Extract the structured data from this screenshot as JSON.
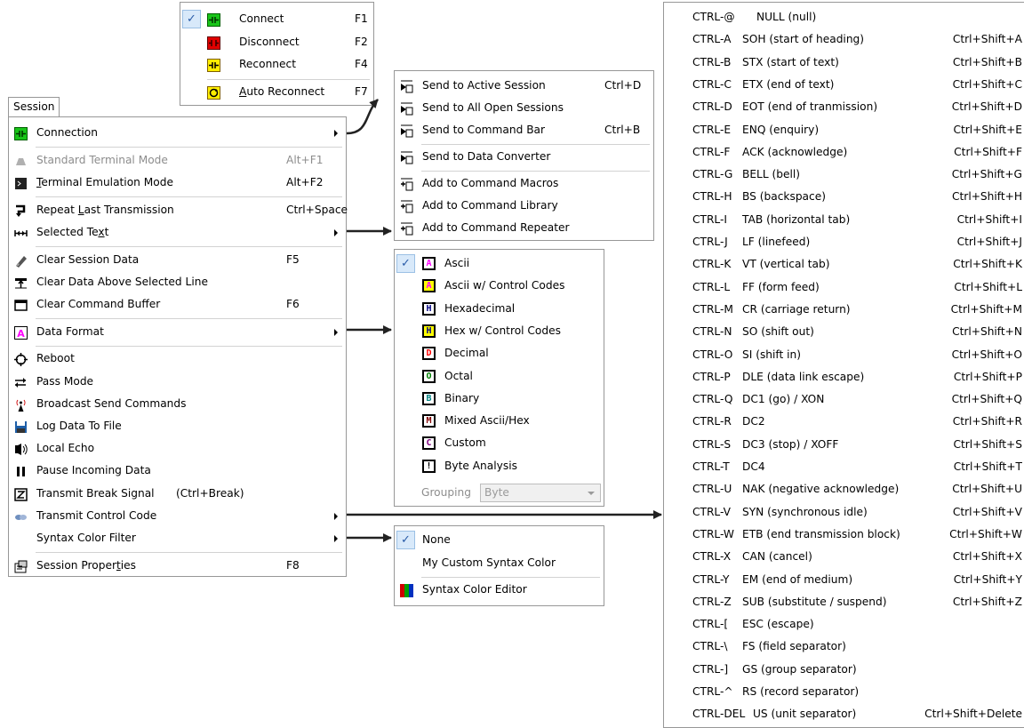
{
  "session_tab": "Session",
  "session_menu": [
    {
      "label": "Connection",
      "icon": "connect-icon",
      "submenu": true
    },
    {
      "sep": true
    },
    {
      "label": "Standard Terminal Mode",
      "icon": "terminal-mode-icon",
      "shortcut": "Alt+F1",
      "disabled": true
    },
    {
      "label": "Terminal Emulation Mode",
      "icon": "terminal-emulation-icon",
      "shortcut": "Alt+F2",
      "ul": "T"
    },
    {
      "sep": true
    },
    {
      "label": "Repeat Last Transmission",
      "icon": "repeat-icon",
      "shortcut": "Ctrl+Space",
      "ul": "L"
    },
    {
      "label": "Selected Text",
      "icon": "selected-text-icon",
      "submenu": true,
      "ul": "x"
    },
    {
      "sep": true
    },
    {
      "label": "Clear Session Data",
      "icon": "eraser-icon",
      "shortcut": "F5"
    },
    {
      "label": "Clear Data Above Selected Line",
      "icon": "clear-above-icon"
    },
    {
      "label": "Clear Command Buffer",
      "icon": "clear-buffer-icon",
      "shortcut": "F6"
    },
    {
      "sep": true
    },
    {
      "label": "Data Format",
      "icon": "data-format-icon",
      "submenu": true
    },
    {
      "sep": true
    },
    {
      "label": "Reboot",
      "icon": "reboot-icon"
    },
    {
      "label": "Pass Mode",
      "icon": "pass-mode-icon"
    },
    {
      "label": "Broadcast Send Commands",
      "icon": "broadcast-icon"
    },
    {
      "label": "Log Data To File",
      "icon": "save-icon"
    },
    {
      "label": "Local Echo",
      "icon": "echo-icon"
    },
    {
      "label": "Pause Incoming Data",
      "icon": "pause-icon"
    },
    {
      "label": "Transmit Break Signal",
      "icon": "break-icon",
      "shortcut_inline": "(Ctrl+Break)"
    },
    {
      "label": "Transmit Control Code",
      "icon": "control-code-icon",
      "submenu": true
    },
    {
      "label": "Syntax Color Filter",
      "icon": "",
      "submenu": true
    },
    {
      "sep": true
    },
    {
      "label": "Session Properties",
      "icon": "properties-icon",
      "shortcut": "F8",
      "ul": "t"
    }
  ],
  "connection_menu": [
    {
      "label": "Connect",
      "shortcut": "F1",
      "checked": true,
      "icon": "connect-icon"
    },
    {
      "label": "Disconnect",
      "shortcut": "F2",
      "icon": "disconnect-icon"
    },
    {
      "label": "Reconnect",
      "shortcut": "F4",
      "icon": "reconnect-icon"
    },
    {
      "sep": true
    },
    {
      "label": "Auto Reconnect",
      "shortcut": "F7",
      "icon": "auto-reconnect-icon",
      "ul": "A"
    }
  ],
  "selected_text_menu": [
    {
      "label": "Send to Active Session",
      "shortcut": "Ctrl+D",
      "icon": "send-active-icon"
    },
    {
      "label": "Send to All Open Sessions",
      "icon": "send-all-icon"
    },
    {
      "label": "Send to Command Bar",
      "shortcut": "Ctrl+B",
      "icon": "send-command-bar-icon"
    },
    {
      "sep": true
    },
    {
      "label": "Send to Data Converter",
      "icon": "send-converter-icon"
    },
    {
      "sep": true
    },
    {
      "label": "Add to Command Macros",
      "icon": "add-macros-icon"
    },
    {
      "label": "Add to Command Library",
      "icon": "add-library-icon"
    },
    {
      "label": "Add to Command Repeater",
      "icon": "add-repeater-icon"
    }
  ],
  "data_format_menu": [
    {
      "label": "Ascii",
      "letter": "A",
      "color": "#ff00ff",
      "bg": "#ffffff",
      "checked": true
    },
    {
      "label": "Ascii w/ Control Codes",
      "letter": "A",
      "color": "#ff00ff",
      "bg": "#ffff00"
    },
    {
      "label": "Hexadecimal",
      "letter": "H",
      "color": "#000080",
      "bg": "#ffffff"
    },
    {
      "label": "Hex w/ Control Codes",
      "letter": "H",
      "color": "#000080",
      "bg": "#ffff00"
    },
    {
      "label": "Decimal",
      "letter": "D",
      "color": "#ff0000",
      "bg": "#ffffff"
    },
    {
      "label": "Octal",
      "letter": "O",
      "color": "#008000",
      "bg": "#ffffff"
    },
    {
      "label": "Binary",
      "letter": "B",
      "color": "#008080",
      "bg": "#ffffff"
    },
    {
      "label": "Mixed Ascii/Hex",
      "letter": "M",
      "color": "#800000",
      "bg": "#ffffff"
    },
    {
      "label": "Custom",
      "letter": "C",
      "color": "#800080",
      "bg": "#ffffff"
    },
    {
      "label": "Byte Analysis",
      "letter": "!",
      "color": "#000000",
      "bg": "#ffffff"
    }
  ],
  "grouping": {
    "label": "Grouping",
    "value": "Byte"
  },
  "syntax_menu": [
    {
      "label": "None",
      "checked": true
    },
    {
      "label": "My Custom Syntax Color"
    },
    {
      "sep": true
    },
    {
      "label": "Syntax Color Editor",
      "icon": "color-editor-icon"
    }
  ],
  "control_codes": [
    {
      "code": "CTRL-@",
      "desc": "NULL (null)",
      "shortcut": ""
    },
    {
      "code": "CTRL-A",
      "desc": "SOH (start of heading)",
      "shortcut": "Ctrl+Shift+A"
    },
    {
      "code": "CTRL-B",
      "desc": "STX (start of text)",
      "shortcut": "Ctrl+Shift+B"
    },
    {
      "code": "CTRL-C",
      "desc": "ETX (end of text)",
      "shortcut": "Ctrl+Shift+C"
    },
    {
      "code": "CTRL-D",
      "desc": "EOT (end of tranmission)",
      "shortcut": "Ctrl+Shift+D"
    },
    {
      "code": "CTRL-E",
      "desc": "ENQ (enquiry)",
      "shortcut": "Ctrl+Shift+E"
    },
    {
      "code": "CTRL-F",
      "desc": "ACK (acknowledge)",
      "shortcut": "Ctrl+Shift+F"
    },
    {
      "code": "CTRL-G",
      "desc": "BELL (bell)",
      "shortcut": "Ctrl+Shift+G"
    },
    {
      "code": "CTRL-H",
      "desc": "BS (backspace)",
      "shortcut": "Ctrl+Shift+H"
    },
    {
      "code": "CTRL-I",
      "desc": "TAB (horizontal tab)",
      "shortcut": "Ctrl+Shift+I"
    },
    {
      "code": "CTRL-J",
      "desc": "LF (linefeed)",
      "shortcut": "Ctrl+Shift+J"
    },
    {
      "code": "CTRL-K",
      "desc": "VT (vertical tab)",
      "shortcut": "Ctrl+Shift+K"
    },
    {
      "code": "CTRL-L",
      "desc": "FF (form feed)",
      "shortcut": "Ctrl+Shift+L"
    },
    {
      "code": "CTRL-M",
      "desc": "CR (carriage return)",
      "shortcut": "Ctrl+Shift+M"
    },
    {
      "code": "CTRL-N",
      "desc": "SO (shift out)",
      "shortcut": "Ctrl+Shift+N"
    },
    {
      "code": "CTRL-O",
      "desc": "SI (shift in)",
      "shortcut": "Ctrl+Shift+O"
    },
    {
      "code": "CTRL-P",
      "desc": "DLE (data link escape)",
      "shortcut": "Ctrl+Shift+P"
    },
    {
      "code": "CTRL-Q",
      "desc": "DC1 (go) / XON",
      "shortcut": "Ctrl+Shift+Q"
    },
    {
      "code": "CTRL-R",
      "desc": "DC2",
      "shortcut": "Ctrl+Shift+R"
    },
    {
      "code": "CTRL-S",
      "desc": "DC3 (stop)  / XOFF",
      "shortcut": "Ctrl+Shift+S"
    },
    {
      "code": "CTRL-T",
      "desc": "DC4",
      "shortcut": "Ctrl+Shift+T"
    },
    {
      "code": "CTRL-U",
      "desc": "NAK (negative acknowledge)",
      "shortcut": "Ctrl+Shift+U"
    },
    {
      "code": "CTRL-V",
      "desc": "SYN (synchronous idle)",
      "shortcut": "Ctrl+Shift+V"
    },
    {
      "code": "CTRL-W",
      "desc": "ETB (end transmission block)",
      "shortcut": "Ctrl+Shift+W"
    },
    {
      "code": "CTRL-X",
      "desc": "CAN (cancel)",
      "shortcut": "Ctrl+Shift+X"
    },
    {
      "code": "CTRL-Y",
      "desc": "EM (end of medium)",
      "shortcut": "Ctrl+Shift+Y"
    },
    {
      "code": "CTRL-Z",
      "desc": "SUB (substitute / suspend)",
      "shortcut": "Ctrl+Shift+Z"
    },
    {
      "code": "CTRL-[",
      "desc": "ESC (escape)",
      "shortcut": ""
    },
    {
      "code": "CTRL-\\",
      "desc": "FS (field separator)",
      "shortcut": ""
    },
    {
      "code": "CTRL-]",
      "desc": "GS (group separator)",
      "shortcut": ""
    },
    {
      "code": "CTRL-^",
      "desc": "RS (record separator)",
      "shortcut": ""
    },
    {
      "code": "CTRL-DEL",
      "desc": "US (unit separator)",
      "shortcut": "Ctrl+Shift+Delete"
    }
  ]
}
